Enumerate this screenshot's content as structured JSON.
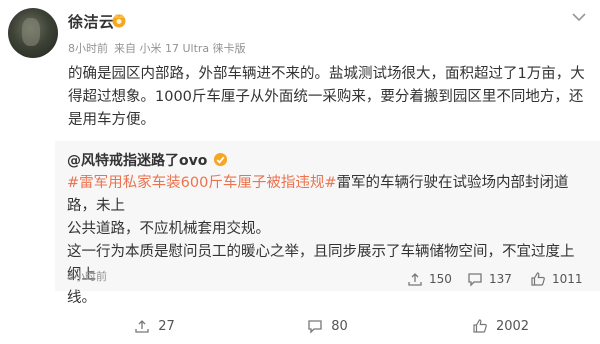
{
  "post": {
    "author": "徐洁云",
    "time": "8小时前",
    "source": "来自 小米 17 Ultra 徕卡版",
    "text_lines": [
      "的确是园区内部路，外部车辆进不来的。盐城测试场很大，面积超过了1万亩，大",
      "得超过想象。1000斤车厘子从外面统一采购来，要分着搬到园区里不同地方，还",
      "是用车方便。"
    ]
  },
  "repost": {
    "author_prefix": "@风特戒指迷路了ovo",
    "topic": "#雷军用私家车装600斤车厘子被指违规#",
    "text_lines": [
      "雷军的车辆行驶在试验场内部封闭道路，未上",
      "公共道路，不应机械套用交规。",
      "这一行为本质是慰问员工的暖心之举，且同步展示了车辆储物空间，不宜过度上纲上",
      "线。"
    ],
    "time": "8小时前",
    "reposts": "150",
    "comments": "137",
    "likes": "1011"
  },
  "actions": {
    "reposts": "27",
    "comments": "80",
    "likes": "2002"
  },
  "colors": {
    "accent": "#eb7350",
    "meta": "#939393",
    "card_bg": "#f7f7f7"
  }
}
